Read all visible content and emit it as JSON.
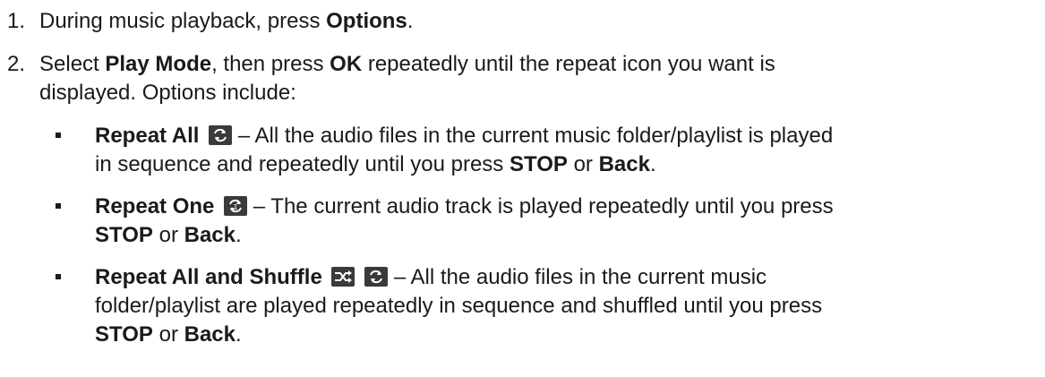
{
  "steps": [
    {
      "number": "1.",
      "parts": [
        "During music playback, press ",
        "Options",
        "."
      ]
    },
    {
      "number": "2.",
      "line1_parts": [
        "Select ",
        "Play Mode",
        ", then press ",
        "OK",
        " repeatedly until the repeat icon you want is"
      ],
      "line2": "displayed. Options include:"
    }
  ],
  "options": [
    {
      "title": "Repeat All",
      "icon": "repeat-all-icon",
      "line1": " – All the audio files in the current music folder/playlist is played",
      "line2_parts": [
        "in sequence and repeatedly until you press ",
        "STOP",
        " or ",
        "Back",
        "."
      ]
    },
    {
      "title": "Repeat One",
      "icon": "repeat-one-icon",
      "line1": " – The current audio track is played repeatedly until you press",
      "line2_parts": [
        "STOP",
        " or ",
        "Back",
        "."
      ]
    },
    {
      "title": "Repeat All and Shuffle",
      "icons": [
        "shuffle-icon",
        "repeat-all-icon"
      ],
      "line1": " – All the audio files in the current music",
      "line2": "folder/playlist are played repeatedly in sequence and shuffled until you press",
      "line3_parts": [
        "STOP",
        " or ",
        "Back",
        "."
      ]
    }
  ]
}
